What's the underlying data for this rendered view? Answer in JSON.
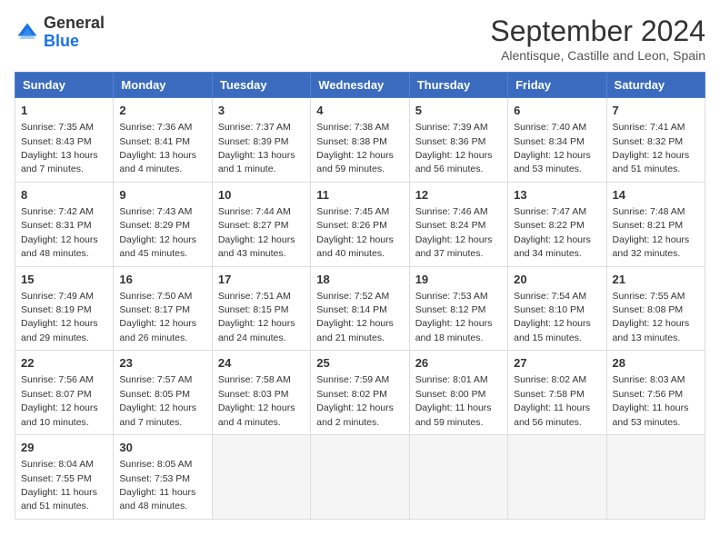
{
  "header": {
    "logo_line1": "General",
    "logo_line2": "Blue",
    "month_year": "September 2024",
    "location": "Alentisque, Castille and Leon, Spain"
  },
  "days_of_week": [
    "Sunday",
    "Monday",
    "Tuesday",
    "Wednesday",
    "Thursday",
    "Friday",
    "Saturday"
  ],
  "weeks": [
    [
      {
        "day": "1",
        "info": "Sunrise: 7:35 AM\nSunset: 8:43 PM\nDaylight: 13 hours and 7 minutes."
      },
      {
        "day": "2",
        "info": "Sunrise: 7:36 AM\nSunset: 8:41 PM\nDaylight: 13 hours and 4 minutes."
      },
      {
        "day": "3",
        "info": "Sunrise: 7:37 AM\nSunset: 8:39 PM\nDaylight: 13 hours and 1 minute."
      },
      {
        "day": "4",
        "info": "Sunrise: 7:38 AM\nSunset: 8:38 PM\nDaylight: 12 hours and 59 minutes."
      },
      {
        "day": "5",
        "info": "Sunrise: 7:39 AM\nSunset: 8:36 PM\nDaylight: 12 hours and 56 minutes."
      },
      {
        "day": "6",
        "info": "Sunrise: 7:40 AM\nSunset: 8:34 PM\nDaylight: 12 hours and 53 minutes."
      },
      {
        "day": "7",
        "info": "Sunrise: 7:41 AM\nSunset: 8:32 PM\nDaylight: 12 hours and 51 minutes."
      }
    ],
    [
      {
        "day": "8",
        "info": "Sunrise: 7:42 AM\nSunset: 8:31 PM\nDaylight: 12 hours and 48 minutes."
      },
      {
        "day": "9",
        "info": "Sunrise: 7:43 AM\nSunset: 8:29 PM\nDaylight: 12 hours and 45 minutes."
      },
      {
        "day": "10",
        "info": "Sunrise: 7:44 AM\nSunset: 8:27 PM\nDaylight: 12 hours and 43 minutes."
      },
      {
        "day": "11",
        "info": "Sunrise: 7:45 AM\nSunset: 8:26 PM\nDaylight: 12 hours and 40 minutes."
      },
      {
        "day": "12",
        "info": "Sunrise: 7:46 AM\nSunset: 8:24 PM\nDaylight: 12 hours and 37 minutes."
      },
      {
        "day": "13",
        "info": "Sunrise: 7:47 AM\nSunset: 8:22 PM\nDaylight: 12 hours and 34 minutes."
      },
      {
        "day": "14",
        "info": "Sunrise: 7:48 AM\nSunset: 8:21 PM\nDaylight: 12 hours and 32 minutes."
      }
    ],
    [
      {
        "day": "15",
        "info": "Sunrise: 7:49 AM\nSunset: 8:19 PM\nDaylight: 12 hours and 29 minutes."
      },
      {
        "day": "16",
        "info": "Sunrise: 7:50 AM\nSunset: 8:17 PM\nDaylight: 12 hours and 26 minutes."
      },
      {
        "day": "17",
        "info": "Sunrise: 7:51 AM\nSunset: 8:15 PM\nDaylight: 12 hours and 24 minutes."
      },
      {
        "day": "18",
        "info": "Sunrise: 7:52 AM\nSunset: 8:14 PM\nDaylight: 12 hours and 21 minutes."
      },
      {
        "day": "19",
        "info": "Sunrise: 7:53 AM\nSunset: 8:12 PM\nDaylight: 12 hours and 18 minutes."
      },
      {
        "day": "20",
        "info": "Sunrise: 7:54 AM\nSunset: 8:10 PM\nDaylight: 12 hours and 15 minutes."
      },
      {
        "day": "21",
        "info": "Sunrise: 7:55 AM\nSunset: 8:08 PM\nDaylight: 12 hours and 13 minutes."
      }
    ],
    [
      {
        "day": "22",
        "info": "Sunrise: 7:56 AM\nSunset: 8:07 PM\nDaylight: 12 hours and 10 minutes."
      },
      {
        "day": "23",
        "info": "Sunrise: 7:57 AM\nSunset: 8:05 PM\nDaylight: 12 hours and 7 minutes."
      },
      {
        "day": "24",
        "info": "Sunrise: 7:58 AM\nSunset: 8:03 PM\nDaylight: 12 hours and 4 minutes."
      },
      {
        "day": "25",
        "info": "Sunrise: 7:59 AM\nSunset: 8:02 PM\nDaylight: 12 hours and 2 minutes."
      },
      {
        "day": "26",
        "info": "Sunrise: 8:01 AM\nSunset: 8:00 PM\nDaylight: 11 hours and 59 minutes."
      },
      {
        "day": "27",
        "info": "Sunrise: 8:02 AM\nSunset: 7:58 PM\nDaylight: 11 hours and 56 minutes."
      },
      {
        "day": "28",
        "info": "Sunrise: 8:03 AM\nSunset: 7:56 PM\nDaylight: 11 hours and 53 minutes."
      }
    ],
    [
      {
        "day": "29",
        "info": "Sunrise: 8:04 AM\nSunset: 7:55 PM\nDaylight: 11 hours and 51 minutes."
      },
      {
        "day": "30",
        "info": "Sunrise: 8:05 AM\nSunset: 7:53 PM\nDaylight: 11 hours and 48 minutes."
      },
      {
        "day": "",
        "info": ""
      },
      {
        "day": "",
        "info": ""
      },
      {
        "day": "",
        "info": ""
      },
      {
        "day": "",
        "info": ""
      },
      {
        "day": "",
        "info": ""
      }
    ]
  ]
}
